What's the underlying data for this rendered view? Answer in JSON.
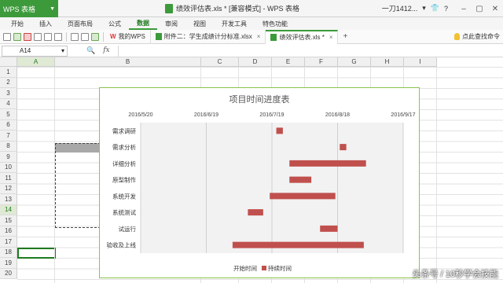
{
  "app": {
    "name": "WPS 表格",
    "window_title": "绩效评估表.xls * [兼容模式] - WPS 表格",
    "user": "一刀1412...",
    "colors": {
      "accent": "#3c9a3a",
      "bar": "#c0504d",
      "plot_bg": "#f2f2f2"
    }
  },
  "menu": [
    "开始",
    "插入",
    "页面布局",
    "公式",
    "数据",
    "审阅",
    "视图",
    "开发工具",
    "特色功能"
  ],
  "menu_active_index": 4,
  "doc_tabs": [
    {
      "label": "我的WPS",
      "icon": "wps-logo-icon"
    },
    {
      "label": "附件二：学生成绩计分标准.xlsx",
      "icon": "spreadsheet-icon"
    },
    {
      "label": "绩效评估表.xls *",
      "icon": "spreadsheet-icon"
    }
  ],
  "help_text": "点此查找命令",
  "formula_bar": {
    "cell_ref": "A14",
    "fx": "fx",
    "value": ""
  },
  "columns": [
    "A",
    "B",
    "C",
    "D",
    "E",
    "F",
    "G",
    "H",
    "I"
  ],
  "rows": [
    "1",
    "2",
    "3",
    "4",
    "5",
    "6",
    "7",
    "8",
    "9",
    "10",
    "11",
    "12",
    "13",
    "14",
    "15",
    "16",
    "17",
    "18",
    "19",
    "20"
  ],
  "selected_row": "14",
  "selected_col": "A",
  "watermark": "头条号 / 10秒学会技能",
  "chart_data": {
    "type": "bar",
    "subtype": "gantt",
    "title": "项目时间进度表",
    "x_ticks": [
      "2016/5/20",
      "2016/6/19",
      "2016/7/19",
      "2016/8/18",
      "2016/9/17"
    ],
    "xlim": [
      "2016/5/20",
      "2016/9/17"
    ],
    "categories": [
      "需求调研",
      "需求分析",
      "详细分析",
      "原型制作",
      "系统开发",
      "系统测试",
      "试运行",
      "验收及上线"
    ],
    "series": [
      {
        "name": "开始时间",
        "color": "none",
        "values": [
          "2016/7/21",
          "2016/8/19",
          "2016/7/27",
          "2016/7/27",
          "2016/7/18",
          "2016/7/8",
          "2016/8/10",
          "2016/7/1"
        ]
      },
      {
        "name": "持续时间",
        "color": "#c0504d",
        "values": [
          3,
          3,
          35,
          10,
          30,
          7,
          8,
          60
        ]
      }
    ],
    "grid": true,
    "legend": "bottom"
  }
}
